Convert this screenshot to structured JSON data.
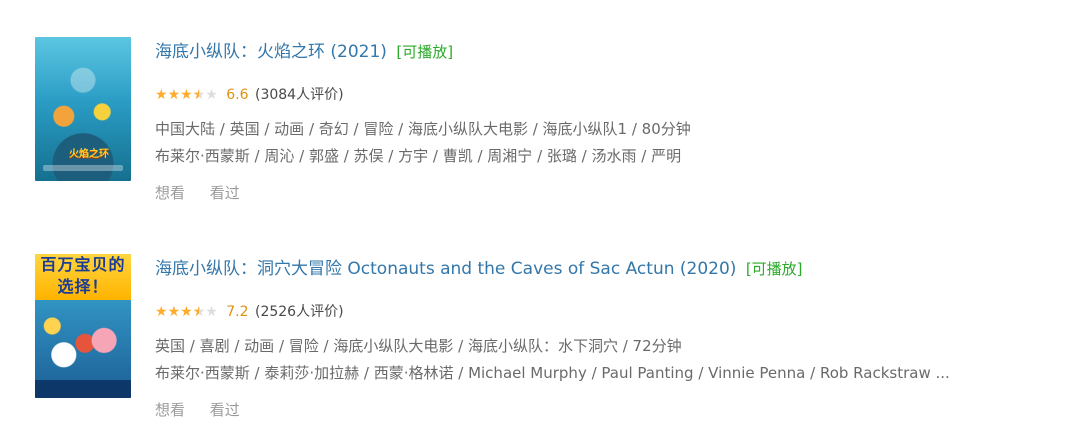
{
  "items": [
    {
      "title": "海底小纵队：火焰之环 (2021)",
      "playable": "[可播放]",
      "rating": 3.5,
      "score": "6.6",
      "votes": "(3084人评价)",
      "meta": "中国大陆 / 英国 / 动画 / 奇幻 / 冒险 / 海底小纵队大电影 / 海底小纵队1 / 80分钟",
      "cast": "布莱尔·西蒙斯 / 周沁 / 郭盛 / 苏俣 / 方宇 / 曹凯 / 周湘宁 / 张璐 / 汤水雨 / 严明",
      "poster_text": "火焰之环",
      "want": "想看",
      "seen": "看过"
    },
    {
      "title": "海底小纵队：洞穴大冒险 Octonauts and the Caves of Sac Actun (2020)",
      "playable": "[可播放]",
      "rating": 3.5,
      "score": "7.2",
      "votes": "(2526人评价)",
      "meta": "英国 / 喜剧 / 动画 / 冒险 / 海底小纵队大电影 / 海底小纵队：水下洞穴 / 72分钟",
      "cast": "布莱尔·西蒙斯 / 泰莉莎·加拉赫 / 西蒙·格林诺 / Michael Murphy / Paul Panting / Vinnie Penna / Rob Rackstraw ...",
      "poster_text": "百万宝贝的选择！",
      "want": "想看",
      "seen": "看过"
    }
  ]
}
